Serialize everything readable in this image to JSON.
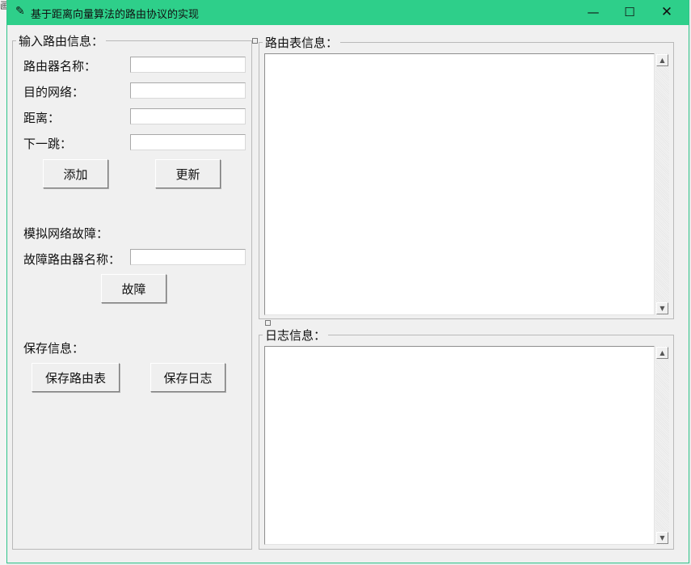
{
  "window": {
    "title": "基于距离向量算法的路由协议的实现",
    "app_icon": "feather-icon",
    "minimize_glyph": "—",
    "maximize_glyph": "☐",
    "close_glyph": "✕"
  },
  "background": {
    "fragment_text": "画"
  },
  "input_section": {
    "title": "输入路由信息：",
    "router_name_label": "路由器名称：",
    "router_name_value": "",
    "dest_network_label": "目的网络：",
    "dest_network_value": "",
    "distance_label": "距离：",
    "distance_value": "",
    "next_hop_label": "下一跳：",
    "next_hop_value": "",
    "add_button": "添加",
    "update_button": "更新"
  },
  "fault_section": {
    "title": "模拟网络故障：",
    "fault_router_label": "故障路由器名称：",
    "fault_router_value": "",
    "fault_button": "故障"
  },
  "save_section": {
    "title": "保存信息：",
    "save_table_button": "保存路由表",
    "save_log_button": "保存日志"
  },
  "routing_table": {
    "title": "路由表信息：",
    "content": ""
  },
  "log": {
    "title": "日志信息：",
    "content": ""
  },
  "colors": {
    "titlebar": "#2ecf8a",
    "window_bg": "#f0f0f0"
  }
}
